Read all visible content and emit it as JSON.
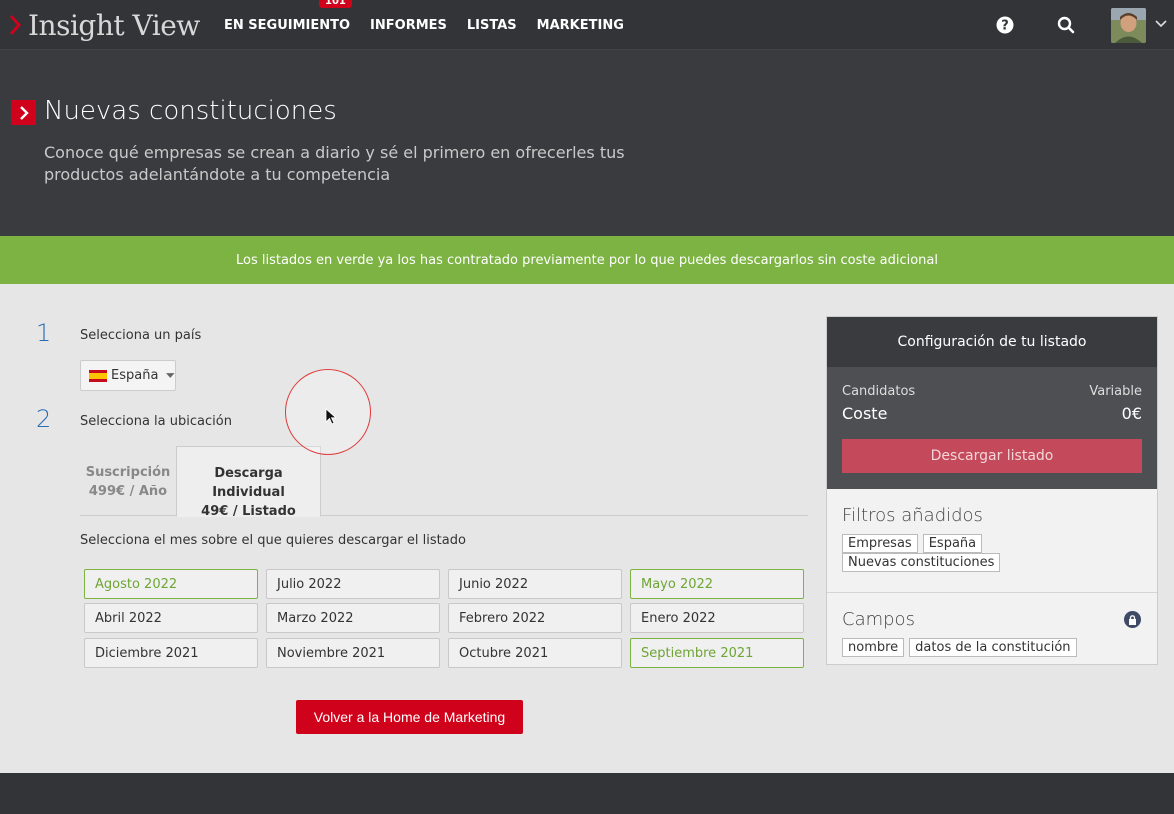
{
  "header": {
    "logo_text": "Insight View",
    "nav": [
      {
        "label": "EN SEGUIMIENTO",
        "badge": "101"
      },
      {
        "label": "INFORMES"
      },
      {
        "label": "LISTAS"
      },
      {
        "label": "MARKETING"
      }
    ],
    "icons": [
      "help-icon",
      "search-icon",
      "avatar",
      "chevron-down-icon"
    ]
  },
  "hero": {
    "title": "Nuevas constituciones",
    "description": "Conoce qué empresas se crean a diario y sé el primero en ofrecerles tus productos adelantándote a tu competencia"
  },
  "notice": "Los listados en verde ya los has contratado previamente por lo que puedes descargarlos sin coste adicional",
  "steps": [
    {
      "number": "1",
      "label": "Selecciona un país"
    },
    {
      "number": "2",
      "label": "Selecciona la ubicación"
    }
  ],
  "country": {
    "selected": "España"
  },
  "tabs": [
    {
      "title": "Suscripción",
      "price": "499€ / Año",
      "active": false
    },
    {
      "title": "Descarga Individual",
      "price": "49€ / Listado",
      "active": true
    }
  ],
  "month_prompt": "Selecciona el mes sobre el que quieres descargar el listado",
  "months": [
    {
      "label": "Agosto 2022",
      "purchased": true
    },
    {
      "label": "Julio 2022",
      "purchased": false
    },
    {
      "label": "Junio 2022",
      "purchased": false
    },
    {
      "label": "Mayo 2022",
      "purchased": true
    },
    {
      "label": "Abril 2022",
      "purchased": false
    },
    {
      "label": "Marzo 2022",
      "purchased": false
    },
    {
      "label": "Febrero 2022",
      "purchased": false
    },
    {
      "label": "Enero 2022",
      "purchased": false
    },
    {
      "label": "Diciembre 2021",
      "purchased": false
    },
    {
      "label": "Noviembre 2021",
      "purchased": false
    },
    {
      "label": "Octubre 2021",
      "purchased": false
    },
    {
      "label": "Septiembre 2021",
      "purchased": true
    }
  ],
  "home_button": "Volver a la Home de Marketing",
  "panel": {
    "title": "Configuración de tu listado",
    "candidates_label": "Candidatos",
    "candidates_value": "Variable",
    "cost_label": "Coste",
    "cost_value": "0€",
    "download_button": "Descargar listado",
    "filters_title": "Filtros añadidos",
    "filters": [
      "Empresas",
      "España",
      "Nuevas constituciones"
    ],
    "fields_title": "Campos",
    "fields": [
      "nombre",
      "datos de la constitución"
    ]
  },
  "colors": {
    "brand_red": "#d0021b",
    "green": "#7cb342",
    "step_blue": "#2a6db5"
  }
}
